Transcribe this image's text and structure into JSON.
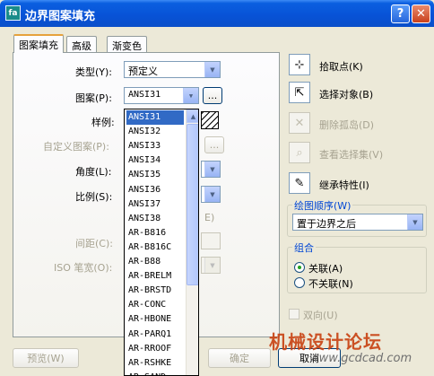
{
  "window": {
    "title": "边界图案填充",
    "app_icon": "hatch-app-icon",
    "help_glyph": "?",
    "close_glyph": "✕"
  },
  "tabs": [
    {
      "label": "图案填充",
      "active": true
    },
    {
      "label": "高级",
      "active": false
    },
    {
      "label": "渐变色",
      "active": false
    }
  ],
  "form": {
    "type_label": "类型(Y):",
    "type_value": "预定义",
    "pattern_label": "图案(P):",
    "pattern_value": "ANSI31",
    "browse_label": "...",
    "sample_label": "样例:",
    "custom_pattern_label": "自定义图案(P):",
    "angle_label": "角度(L):",
    "scale_label": "比例(S):",
    "spacing_label": "间距(C):",
    "iso_pen_label": "ISO 笔宽(O):",
    "suffix_e": "E)"
  },
  "pattern_list": [
    "ANSI31",
    "ANSI32",
    "ANSI33",
    "ANSI34",
    "ANSI35",
    "ANSI36",
    "ANSI37",
    "ANSI38",
    "AR-B816",
    "AR-B816C",
    "AR-B88",
    "AR-BRELM",
    "AR-BRSTD",
    "AR-CONC",
    "AR-HBONE",
    "AR-PARQ1",
    "AR-RROOF",
    "AR-RSHKE",
    "AR-SAND"
  ],
  "selected_pattern_index": 0,
  "actions": {
    "pick_points": "拾取点(K)",
    "select_objects": "选择对象(B)",
    "remove_islands": "删除孤岛(D)",
    "view_selection": "查看选择集(V)",
    "inherit_properties": "继承特性(I)"
  },
  "draw_order": {
    "title": "绘图顺序(W)",
    "value": "置于边界之后"
  },
  "composition": {
    "title": "组合",
    "associative": "关联(A)",
    "nonassociative": "不关联(N)",
    "selected": "associative"
  },
  "double_label": "双向(U)",
  "bottom": {
    "preview": "预览(W)",
    "ok": "确定",
    "cancel": "取消"
  },
  "watermark": {
    "text": "机械设计论坛",
    "url": "www.gcdcad.com"
  },
  "colors": {
    "titlebar": "#0852d6",
    "selection": "#316ac5",
    "group_title": "#0046d5",
    "watermark": "#c84010"
  }
}
